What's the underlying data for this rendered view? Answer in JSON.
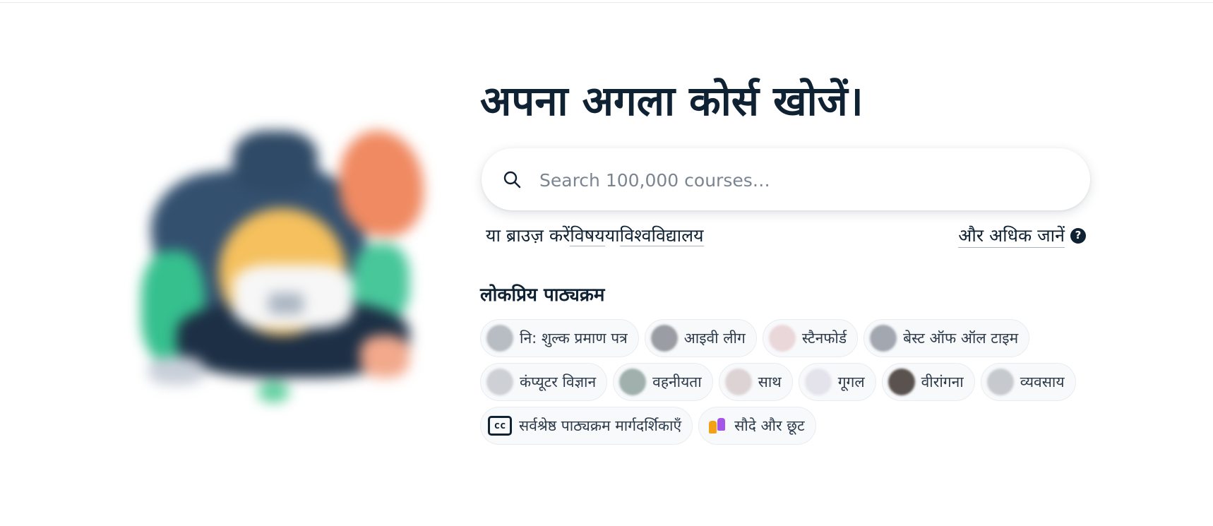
{
  "hero": {
    "headline": "अपना अगला कोर्स खोजें।"
  },
  "search": {
    "placeholder": "Search 100,000 courses…",
    "value": ""
  },
  "browse": {
    "prefix": "या ब्राउज़ करें",
    "subjects_label": "विषय",
    "separator": "या",
    "universities_label": "विश्वविद्यालय"
  },
  "learn_more": {
    "label": "और अधिक जानें",
    "help_glyph": "?"
  },
  "popular": {
    "title": "लोकप्रिय पाठ्यक्रम",
    "chips": [
      {
        "label": "नि: शुल्क प्रमाण पत्र",
        "avatar_color": "#b8bcc3"
      },
      {
        "label": "आइवी लीग",
        "avatar_color": "#9a9ea4"
      },
      {
        "label": "स्टैनफोर्ड",
        "avatar_color": "#ead7da"
      },
      {
        "label": "बेस्ट ऑफ ऑल टाइम",
        "avatar_color": "#a2a7b0"
      },
      {
        "label": "कंप्यूटर विज्ञान",
        "avatar_color": "#cdd0d5"
      },
      {
        "label": "वहनीयता",
        "avatar_color": "#9fb0ad"
      },
      {
        "label": "साथ",
        "avatar_color": "#ddd3d5"
      },
      {
        "label": "गूगल",
        "avatar_color": "#e4e3ec"
      },
      {
        "label": "वीरांगना",
        "avatar_color": "#5a524e"
      },
      {
        "label": "व्यवसाय",
        "avatar_color": "#c6c9ce"
      }
    ],
    "guides": {
      "label": "सर्वश्रेष्ठ पाठ्यक्रम मार्गदर्शिकाएँ",
      "icon": "cc-icon",
      "icon_text": "cc"
    },
    "deals": {
      "label": "सौदे और छूट",
      "icon": "price-tag-icon"
    }
  }
}
